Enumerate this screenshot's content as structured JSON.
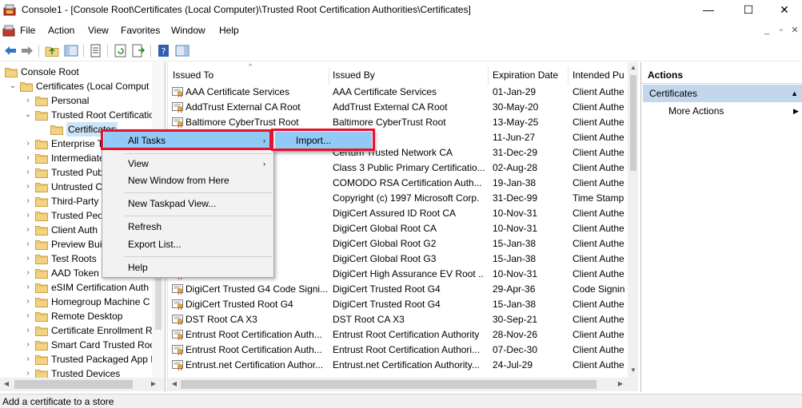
{
  "window": {
    "title": "Console1 - [Console Root\\Certificates (Local Computer)\\Trusted Root Certification Authorities\\Certificates]",
    "minimize": "—",
    "maximize": "☐",
    "close": "✕"
  },
  "menu": {
    "items": [
      "File",
      "Action",
      "View",
      "Favorites",
      "Window",
      "Help"
    ],
    "mdi_minimize": "_",
    "mdi_restore": "▫",
    "mdi_close": "✕"
  },
  "tree": {
    "items": [
      {
        "label": "Console Root",
        "icon": "folder-icon"
      },
      {
        "label": "Certificates (Local Comput",
        "icon": "certificate-store-icon"
      },
      {
        "label": "Personal",
        "icon": "folder-icon"
      },
      {
        "label": "Trusted Root Certificatio",
        "icon": "folder-icon"
      },
      {
        "label": "Certificates",
        "icon": "folder-open-icon"
      },
      {
        "label": "Enterprise Tr",
        "icon": "folder-icon"
      },
      {
        "label": "Intermediate",
        "icon": "folder-icon"
      },
      {
        "label": "Trusted Pub",
        "icon": "folder-icon"
      },
      {
        "label": "Untrusted C",
        "icon": "folder-icon"
      },
      {
        "label": "Third-Party",
        "icon": "folder-icon"
      },
      {
        "label": "Trusted Peo",
        "icon": "folder-icon"
      },
      {
        "label": "Client Auth",
        "icon": "folder-icon"
      },
      {
        "label": "Preview Bui",
        "icon": "folder-icon"
      },
      {
        "label": "Test Roots",
        "icon": "folder-icon"
      },
      {
        "label": "AAD Token",
        "icon": "folder-icon"
      },
      {
        "label": "eSIM Certification Auth",
        "icon": "folder-icon"
      },
      {
        "label": "Homegroup Machine C",
        "icon": "folder-icon"
      },
      {
        "label": "Remote Desktop",
        "icon": "folder-icon"
      },
      {
        "label": "Certificate Enrollment R",
        "icon": "folder-icon"
      },
      {
        "label": "Smart Card Trusted Roo",
        "icon": "folder-icon"
      },
      {
        "label": "Trusted Packaged App I",
        "icon": "folder-icon"
      },
      {
        "label": "Trusted Devices",
        "icon": "folder-icon"
      }
    ]
  },
  "list": {
    "columns": [
      "Issued To",
      "Issued By",
      "Expiration Date",
      "Intended Pu"
    ],
    "rows": [
      {
        "issued_to": "AAA Certificate Services",
        "issued_by": "AAA Certificate Services",
        "expiration": "01-Jan-29",
        "purpose": "Client Authe"
      },
      {
        "issued_to": "AddTrust External CA Root",
        "issued_by": "AddTrust External CA Root",
        "expiration": "30-May-20",
        "purpose": "Client Authe"
      },
      {
        "issued_to": "Baltimore CyberTrust Root",
        "issued_by": "Baltimore CyberTrust Root",
        "expiration": "13-May-25",
        "purpose": "Client Authe"
      },
      {
        "issued_to": "",
        "issued_by": "A",
        "expiration": "11-Jun-27",
        "purpose": "Client Authe"
      },
      {
        "issued_to": "ork CA",
        "issued_by": "Certum Trusted Network CA",
        "expiration": "31-Dec-29",
        "purpose": "Client Authe"
      },
      {
        "issued_to": "y Certificat...",
        "issued_by": "Class 3 Public Primary Certificatio...",
        "expiration": "02-Aug-28",
        "purpose": "Client Authe"
      },
      {
        "issued_to": "tion Au...",
        "issued_by": "COMODO RSA Certification Auth...",
        "expiration": "19-Jan-38",
        "purpose": "Client Authe"
      },
      {
        "issued_to": "icrosoft C...",
        "issued_by": "Copyright (c) 1997 Microsoft Corp.",
        "expiration": "31-Dec-99",
        "purpose": "Time Stamp"
      },
      {
        "issued_to": "oot CA",
        "issued_by": "DigiCert Assured ID Root CA",
        "expiration": "10-Nov-31",
        "purpose": "Client Authe"
      },
      {
        "issued_to": "CA",
        "issued_by": "DigiCert Global Root CA",
        "expiration": "10-Nov-31",
        "purpose": "Client Authe"
      },
      {
        "issued_to": "G2",
        "issued_by": "DigiCert Global Root G2",
        "expiration": "15-Jan-38",
        "purpose": "Client Authe"
      },
      {
        "issued_to": "G3",
        "issued_by": "DigiCert Global Root G3",
        "expiration": "15-Jan-38",
        "purpose": "Client Authe"
      },
      {
        "issued_to": "e EV Root ...",
        "issued_by": "DigiCert High Assurance EV Root ...",
        "expiration": "10-Nov-31",
        "purpose": "Client Authe"
      },
      {
        "issued_to": "DigiCert Trusted G4 Code Signi...",
        "issued_by": "DigiCert Trusted Root G4",
        "expiration": "29-Apr-36",
        "purpose": "Code Signin"
      },
      {
        "issued_to": "DigiCert Trusted Root G4",
        "issued_by": "DigiCert Trusted Root G4",
        "expiration": "15-Jan-38",
        "purpose": "Client Authe"
      },
      {
        "issued_to": "DST Root CA X3",
        "issued_by": "DST Root CA X3",
        "expiration": "30-Sep-21",
        "purpose": "Client Authe"
      },
      {
        "issued_to": "Entrust Root Certification Auth...",
        "issued_by": "Entrust Root Certification Authority",
        "expiration": "28-Nov-26",
        "purpose": "Client Authe"
      },
      {
        "issued_to": "Entrust Root Certification Auth...",
        "issued_by": "Entrust Root Certification Authori...",
        "expiration": "07-Dec-30",
        "purpose": "Client Authe"
      },
      {
        "issued_to": "Entrust.net Certification Author...",
        "issued_by": "Entrust.net Certification Authority...",
        "expiration": "24-Jul-29",
        "purpose": "Client Authe"
      }
    ]
  },
  "actions": {
    "header": "Actions",
    "section": "Certificates",
    "more_actions": "More Actions"
  },
  "context_menu": {
    "items": [
      "All Tasks",
      "View",
      "New Window from Here",
      "New Taskpad View...",
      "Refresh",
      "Export List...",
      "Help"
    ],
    "submenu_item": "Import..."
  },
  "status": {
    "text": "Add a certificate to a store"
  },
  "colors": {
    "highlight": "#91c9f7",
    "red_outline": "#e8112d",
    "actions_section": "#c3d7ec",
    "folder": "#e8c165"
  }
}
